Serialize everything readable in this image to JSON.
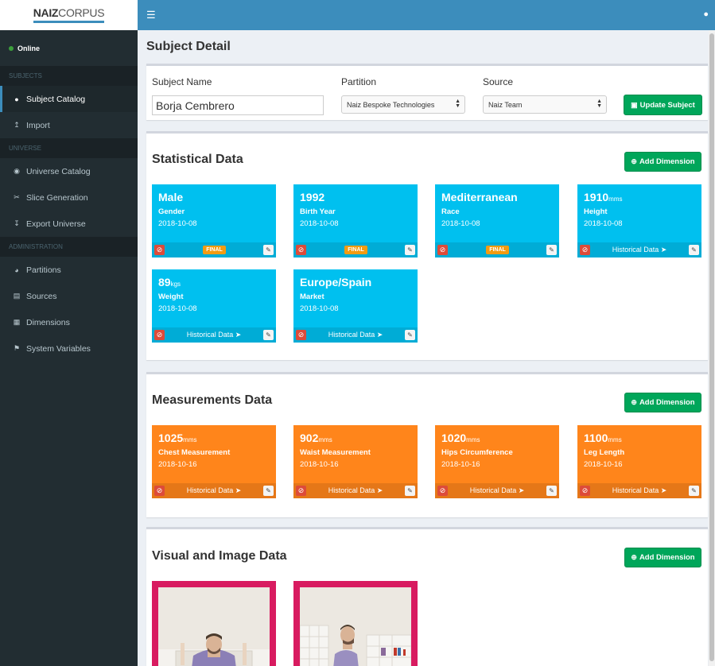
{
  "brand": {
    "bold": "NAIZ",
    "light": "CORPUS"
  },
  "sidebar": {
    "status": "Online",
    "sections": {
      "subjects": "SUBJECTS",
      "universe": "UNIVERSE",
      "administration": "ADMINISTRATION"
    },
    "items": [
      {
        "label": "Subject Catalog",
        "icon": "user-icon"
      },
      {
        "label": "Import",
        "icon": "upload-icon"
      },
      {
        "label": "Universe Catalog",
        "icon": "globe-icon"
      },
      {
        "label": "Slice Generation",
        "icon": "scissors-icon"
      },
      {
        "label": "Export Universe",
        "icon": "download-icon"
      },
      {
        "label": "Partitions",
        "icon": "pie-chart-icon"
      },
      {
        "label": "Sources",
        "icon": "book-icon"
      },
      {
        "label": "Dimensions",
        "icon": "cubes-icon"
      },
      {
        "label": "System Variables",
        "icon": "flag-icon"
      }
    ]
  },
  "page": {
    "title": "Subject Detail"
  },
  "form": {
    "subject_name_label": "Subject Name",
    "subject_name_value": "Borja Cembrero",
    "partition_label": "Partition",
    "partition_value": "Naiz Bespoke Technologies",
    "source_label": "Source",
    "source_value": "Naiz Team",
    "update_button": "Update Subject"
  },
  "add_dimension_label": "Add Dimension",
  "final_label": "FINAL",
  "historical_label": "Historical Data",
  "statistical": {
    "title": "Statistical Data",
    "cards": [
      {
        "value": "Male",
        "unit": "",
        "name": "Gender",
        "date": "2018-10-08",
        "final": true
      },
      {
        "value": "1992",
        "unit": "",
        "name": "Birth Year",
        "date": "2018-10-08",
        "final": true
      },
      {
        "value": "Mediterranean",
        "unit": "",
        "name": "Race",
        "date": "2018-10-08",
        "final": true
      },
      {
        "value": "1910",
        "unit": "mms",
        "name": "Height",
        "date": "2018-10-08",
        "final": false
      },
      {
        "value": "89",
        "unit": "kgs",
        "name": "Weight",
        "date": "2018-10-08",
        "final": false
      },
      {
        "value": "Europe/Spain",
        "unit": "",
        "name": "Market",
        "date": "2018-10-08",
        "final": false
      }
    ]
  },
  "measurements": {
    "title": "Measurements Data",
    "cards": [
      {
        "value": "1025",
        "unit": "mms",
        "name": "Chest Measurement",
        "date": "2018-10-16"
      },
      {
        "value": "902",
        "unit": "mms",
        "name": "Waist Measurement",
        "date": "2018-10-16"
      },
      {
        "value": "1020",
        "unit": "mms",
        "name": "Hips Circumference",
        "date": "2018-10-16"
      },
      {
        "value": "1100",
        "unit": "mms",
        "name": "Leg Length",
        "date": "2018-10-16"
      }
    ]
  },
  "visual": {
    "title": "Visual and Image Data"
  },
  "colors": {
    "primary": "#3c8dbc",
    "sidebar": "#222d32",
    "success": "#00a65a",
    "info": "#00c0ef",
    "orange": "#ff851b",
    "maroon": "#d81b60",
    "danger": "#dd4b39",
    "warning": "#f39c12"
  }
}
